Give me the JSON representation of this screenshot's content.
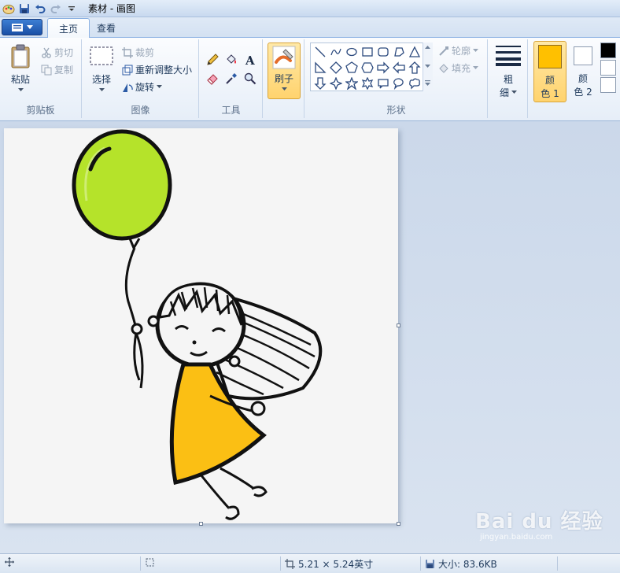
{
  "window": {
    "title": "素材 - 画图"
  },
  "tabs": [
    {
      "label": "主页",
      "active": true
    },
    {
      "label": "查看",
      "active": false
    }
  ],
  "clipboard": {
    "paste": "粘贴",
    "cut": "剪切",
    "copy": "复制",
    "group_label": "剪贴板"
  },
  "image": {
    "select": "选择",
    "crop": "裁剪",
    "resize": "重新调整大小",
    "rotate": "旋转",
    "group_label": "图像"
  },
  "tools": {
    "group_label": "工具",
    "items": [
      "pencil-icon",
      "fill-bucket-icon",
      "text-icon",
      "eraser-icon",
      "color-picker-icon",
      "magnifier-icon"
    ]
  },
  "brushes": {
    "label": "刷子"
  },
  "shapes": {
    "outline": "轮廓",
    "fill": "填充",
    "group_label": "形状",
    "items": [
      "line",
      "curve",
      "oval",
      "rectangle",
      "rounded-rectangle",
      "polygon",
      "triangle",
      "right-triangle",
      "diamond",
      "pentagon",
      "hexagon",
      "right-arrow",
      "left-arrow",
      "up-arrow",
      "down-arrow",
      "four-point-star",
      "five-point-star",
      "six-point-star",
      "callout-rect",
      "callout-oval",
      "callout-cloud"
    ]
  },
  "size": {
    "label_line1": "粗",
    "label_line2": "细"
  },
  "color1": {
    "label_line1": "颜",
    "label_line2": "色 1",
    "value": "#ffc000"
  },
  "color2": {
    "label_line1": "颜",
    "label_line2": "色 2",
    "value": "#ffffff"
  },
  "palette": [
    "#000000",
    "#ffffff",
    "#ffffff"
  ],
  "status": {
    "dimensions": "5.21 × 5.24英寸",
    "size": "大小: 83.6KB"
  },
  "watermark": {
    "main": "Bai du 经验",
    "sub": "jingyan.baidu.com"
  },
  "colors": {
    "balloon": "#b5e32a",
    "dress": "#fbbf14",
    "ribbon_bg": "#f4f8fd",
    "accent": "#1a4fa5"
  }
}
